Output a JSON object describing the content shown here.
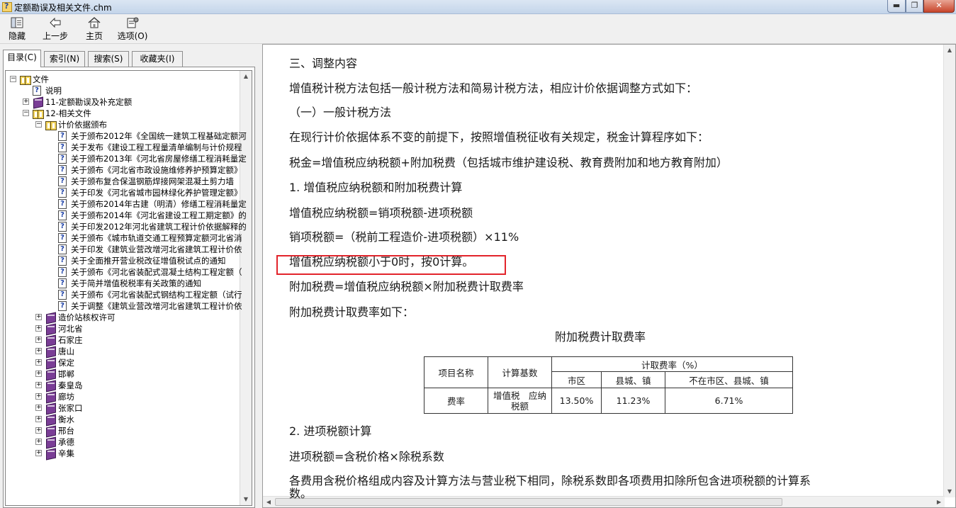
{
  "window": {
    "title": "定额勘误及相关文件.chm",
    "buttons": {
      "minimize": "▬",
      "maximize": "❐",
      "close": "✕"
    }
  },
  "toolbar": {
    "hide": "隐藏",
    "back": "上一步",
    "home": "主页",
    "options": "选项(O)"
  },
  "tabs": [
    "目录(C)",
    "索引(N)",
    "搜索(S)",
    "收藏夹(I)"
  ],
  "tree": [
    {
      "depth": 0,
      "expander": "minus",
      "icon": "open",
      "label": "文件"
    },
    {
      "depth": 1,
      "expander": "none",
      "icon": "page",
      "label": "说明"
    },
    {
      "depth": 1,
      "expander": "plus",
      "icon": "closed",
      "label": "11-定额勘误及补充定额"
    },
    {
      "depth": 1,
      "expander": "minus",
      "icon": "open",
      "label": "12-相关文件"
    },
    {
      "depth": 2,
      "expander": "minus",
      "icon": "open",
      "label": "计价依据颁布"
    },
    {
      "depth": 3,
      "expander": "none",
      "icon": "page",
      "label": "关于颁布2012年《全国统一建筑工程基础定额河"
    },
    {
      "depth": 3,
      "expander": "none",
      "icon": "page",
      "label": "关于发布《建设工程工程量清单编制与计价规程"
    },
    {
      "depth": 3,
      "expander": "none",
      "icon": "page",
      "label": "关于颁布2013年《河北省房屋修缮工程消耗量定"
    },
    {
      "depth": 3,
      "expander": "none",
      "icon": "page",
      "label": "关于颁布《河北省市政设施维修养护预算定额》"
    },
    {
      "depth": 3,
      "expander": "none",
      "icon": "page",
      "label": "关于颁布复合保温钢筋焊接网架混凝土剪力墙"
    },
    {
      "depth": 3,
      "expander": "none",
      "icon": "page",
      "label": "关于印发《河北省城市园林绿化养护管理定额》"
    },
    {
      "depth": 3,
      "expander": "none",
      "icon": "page",
      "label": "关于颁布2014年古建（明清）修缮工程消耗量定"
    },
    {
      "depth": 3,
      "expander": "none",
      "icon": "page",
      "label": "关于颁布2014年《河北省建设工程工期定额》的"
    },
    {
      "depth": 3,
      "expander": "none",
      "icon": "page",
      "label": "关于印发2012年河北省建筑工程计价依据解释的"
    },
    {
      "depth": 3,
      "expander": "none",
      "icon": "page",
      "label": "关于颁布《城市轨道交通工程预算定额河北省消"
    },
    {
      "depth": 3,
      "expander": "none",
      "icon": "page",
      "label": "关于印发《建筑业营改增河北省建筑工程计价依"
    },
    {
      "depth": 3,
      "expander": "none",
      "icon": "page",
      "label": "关于全面推开营业税改征增值税试点的通知"
    },
    {
      "depth": 3,
      "expander": "none",
      "icon": "page",
      "label": "关于颁布《河北省装配式混凝土结构工程定额（"
    },
    {
      "depth": 3,
      "expander": "none",
      "icon": "page",
      "label": "关于简并增值税税率有关政策的通知"
    },
    {
      "depth": 3,
      "expander": "none",
      "icon": "page",
      "label": "关于颁布《河北省装配式钢结构工程定额（试行"
    },
    {
      "depth": 3,
      "expander": "none",
      "icon": "page",
      "label": "关于调整《建筑业营改增河北省建筑工程计价依"
    },
    {
      "depth": 2,
      "expander": "plus",
      "icon": "closed",
      "label": "造价站核权许可"
    },
    {
      "depth": 2,
      "expander": "plus",
      "icon": "closed",
      "label": "河北省"
    },
    {
      "depth": 2,
      "expander": "plus",
      "icon": "closed",
      "label": "石家庄"
    },
    {
      "depth": 2,
      "expander": "plus",
      "icon": "closed",
      "label": "唐山"
    },
    {
      "depth": 2,
      "expander": "plus",
      "icon": "closed",
      "label": "保定"
    },
    {
      "depth": 2,
      "expander": "plus",
      "icon": "closed",
      "label": "邯郸"
    },
    {
      "depth": 2,
      "expander": "plus",
      "icon": "closed",
      "label": "秦皇岛"
    },
    {
      "depth": 2,
      "expander": "plus",
      "icon": "closed",
      "label": "廊坊"
    },
    {
      "depth": 2,
      "expander": "plus",
      "icon": "closed",
      "label": "张家口"
    },
    {
      "depth": 2,
      "expander": "plus",
      "icon": "closed",
      "label": "衡水"
    },
    {
      "depth": 2,
      "expander": "plus",
      "icon": "closed",
      "label": "邢台"
    },
    {
      "depth": 2,
      "expander": "plus",
      "icon": "closed",
      "label": "承德"
    },
    {
      "depth": 2,
      "expander": "plus",
      "icon": "closed",
      "label": "辛集"
    }
  ],
  "content": {
    "lines": [
      "三、调整内容",
      "增值税计税方法包括一般计税方法和简易计税方法，相应计价依据调整方式如下：",
      "（一）一般计税方法",
      "在现行计价依据体系不变的前提下，按照增值税征收有关规定，税金计算程序如下：",
      "税金=增值税应纳税额+附加税费（包括城市维护建设税、教育费附加和地方教育附加）",
      "1.  增值税应纳税额和附加税费计算",
      "增值税应纳税额=销项税额-进项税额",
      "销项税额=（税前工程造价-进项税额）×11%",
      "增值税应纳税额小于0时，按0计算。",
      "附加税费=增值税应纳税额×附加税费计取费率",
      "附加税费计取费率如下："
    ],
    "table_title": "附加税费计取费率",
    "table": {
      "h_name": "项目名称",
      "h_base": "计算基数",
      "h_rate": "计取费率（%）",
      "h_city": "市区",
      "h_county": "县城、镇",
      "h_other": "不在市区、县城、镇",
      "r_name": "费率",
      "r_base": "增值税　应纳税额",
      "r_city": "13.50%",
      "r_county": "11.23%",
      "r_other": "6.71%"
    },
    "after_lines": [
      "2.  进项税额计算",
      "进项税额=含税价格×除税系数",
      "各费用含税价格组成内容及计算方法与营业税下相同，除税系数即各项费用扣除所包含进项税额的计算系",
      "数。"
    ]
  },
  "colors": {
    "highlight": "#e2242b",
    "titlebar": "#c4d5ea"
  }
}
